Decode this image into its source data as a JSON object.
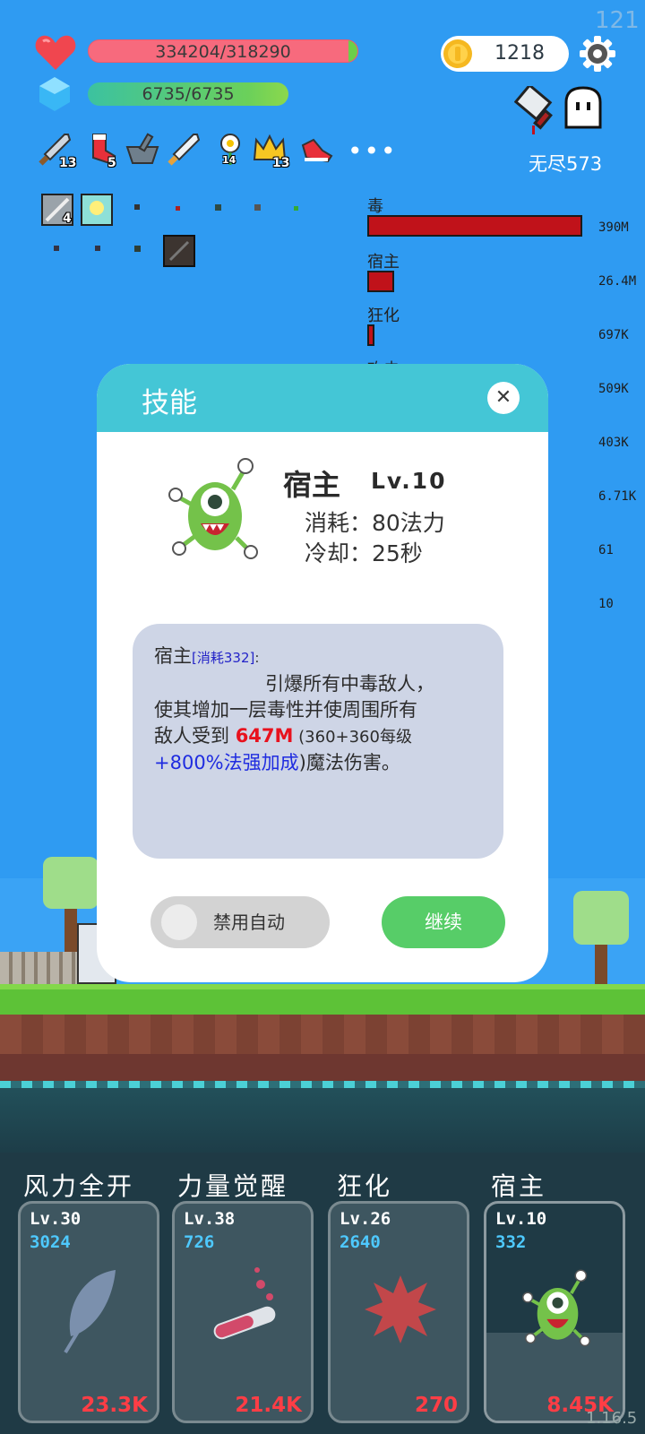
{
  "hud": {
    "fps": "121",
    "hp": "334204/318290",
    "mp": "6735/6735",
    "coins": "1218",
    "mode": "无尽573"
  },
  "items_row1": [
    {
      "icon": "sword-icon",
      "count": "13"
    },
    {
      "icon": "sock-icon",
      "count": "5"
    },
    {
      "icon": "mortar-icon",
      "count": ""
    },
    {
      "icon": "silver-sword-icon",
      "count": ""
    },
    {
      "icon": "flower-icon",
      "count": "14"
    },
    {
      "icon": "crown-icon",
      "count": "13"
    },
    {
      "icon": "shoe-icon",
      "count": ""
    }
  ],
  "items_row2_badge": "4",
  "more_label": "•••",
  "damage_stats": [
    {
      "label": "毒",
      "value": "390M",
      "fraction": 1.0
    },
    {
      "label": "宿主",
      "value": "26.4M",
      "fraction": 0.068
    },
    {
      "label": "狂化",
      "value": "697K",
      "fraction": 0.018
    },
    {
      "label": "攻击",
      "value": "509K",
      "fraction": 0
    },
    {
      "label": "",
      "value": "403K",
      "fraction": 0
    },
    {
      "label": "",
      "value": "6.71K",
      "fraction": 0
    },
    {
      "label": "",
      "value": "61",
      "fraction": 0
    },
    {
      "label": "",
      "value": "10",
      "fraction": 0
    }
  ],
  "dialog": {
    "title": "技能",
    "close": "✕",
    "skill_name": "宿主",
    "skill_level": "Lv.10",
    "cost_line": "消耗：80法力",
    "cooldown_line": "冷却：25秒",
    "desc_name": "宿主",
    "desc_cost": "[消耗332]",
    "desc_colon": ":",
    "desc_line1": "引爆所有中毒敌人，",
    "desc_line2": "使其增加一层毒性并使周围所有",
    "desc_line3_a": "敌人受到 ",
    "desc_damage": "647M",
    "desc_line3_b": " (360+360每级",
    "desc_bonus": "+800%法强加成",
    "desc_line4_b": ")魔法伤害。",
    "auto_toggle": "禁用自动",
    "continue": "继续"
  },
  "skills": [
    {
      "title": "风力全开",
      "level": "Lv.30",
      "cost": "3024",
      "damage": "23.3K",
      "icon": "feather-icon"
    },
    {
      "title": "力量觉醒",
      "level": "Lv.38",
      "cost": "726",
      "damage": "21.4K",
      "icon": "potion-icon"
    },
    {
      "title": "狂化",
      "level": "Lv.26",
      "cost": "2640",
      "damage": "270",
      "icon": "splat-icon"
    },
    {
      "title": "宿主",
      "level": "Lv.10",
      "cost": "332",
      "damage": "8.45K",
      "icon": "monster-icon"
    }
  ],
  "version": "1.16.5",
  "colors": {
    "sky": "#2f9bf2",
    "dialog_header": "#44c6d6",
    "continue": "#57cd68",
    "damage_red": "#e8121e"
  }
}
